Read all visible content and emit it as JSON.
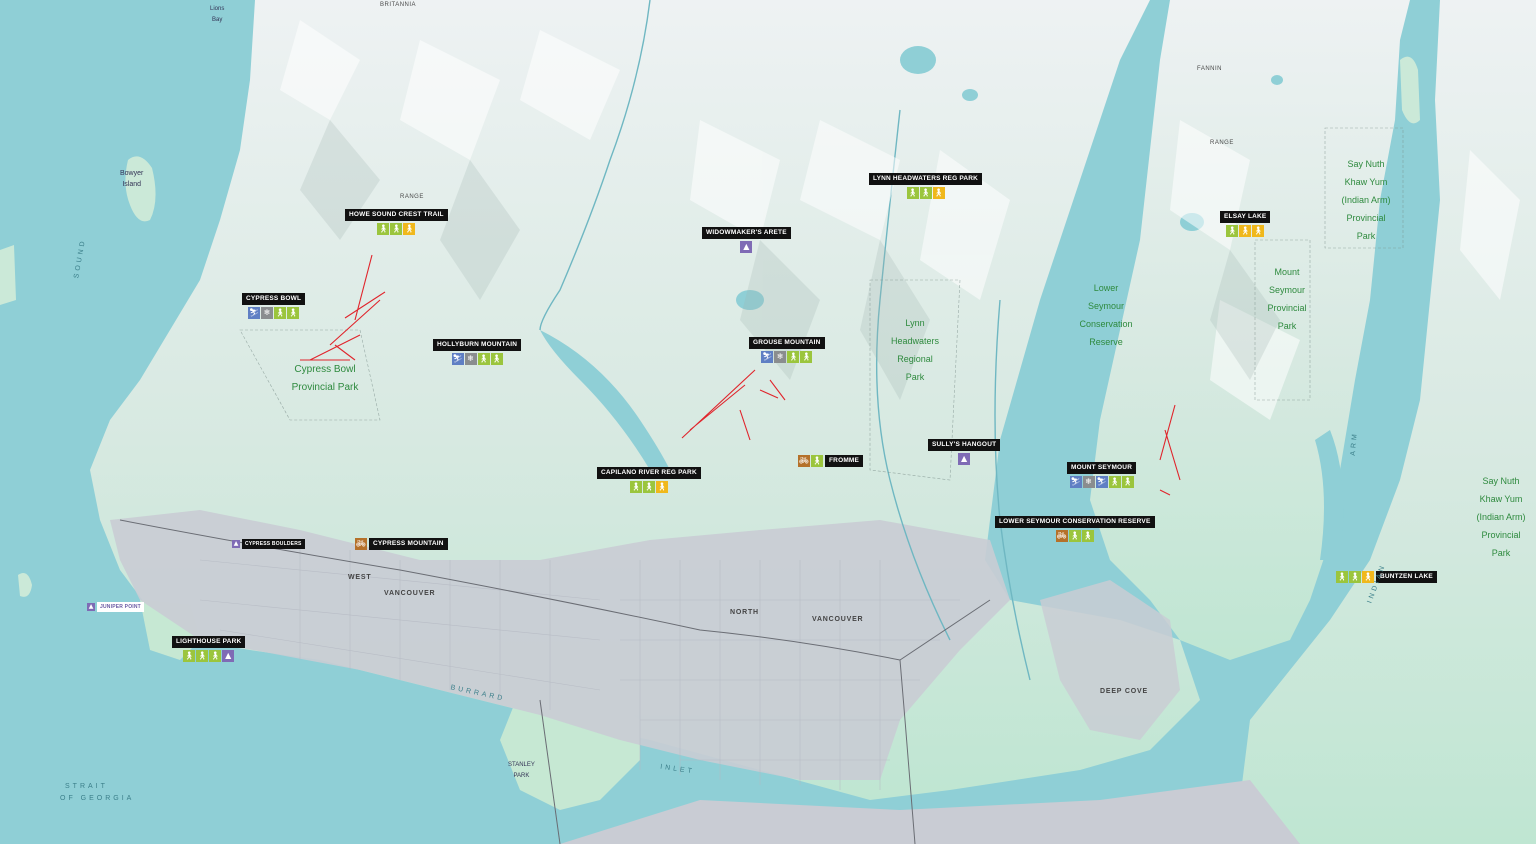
{
  "map": {
    "colors": {
      "water": "#8fcfd6",
      "land": "#bfe6d2",
      "mountain": "#e8eef0",
      "urban": "#c9ccd4",
      "park_text": "#2e8a3e",
      "lift": "#e0242b",
      "label_bg": "#111111"
    },
    "activity_colors": {
      "ski": "#5f7fc4",
      "snowshoe": "#8a8d8f",
      "hike": "#9bc53d",
      "walk": "#f0b81c",
      "climb": "#7f6bb5",
      "bike": "#b5712a"
    },
    "pois": [
      {
        "label": "HOWE SOUND CREST TRAIL",
        "icons": [
          "hike",
          "hike",
          "walk"
        ]
      },
      {
        "label": "CYPRESS BOWL",
        "icons": [
          "ski",
          "snowshoe",
          "hike",
          "hike"
        ]
      },
      {
        "label": "HOLLYBURN MOUNTAIN",
        "icons": [
          "ski",
          "snowshoe",
          "hike",
          "hike"
        ]
      },
      {
        "label": "WIDOWMAKER'S ARETE",
        "icons": [
          "climb"
        ]
      },
      {
        "label": "GROUSE MOUNTAIN",
        "icons": [
          "ski",
          "snowshoe",
          "hike",
          "hike"
        ]
      },
      {
        "label": "LYNN HEADWATERS REG PARK",
        "icons": [
          "hike",
          "hike",
          "walk"
        ]
      },
      {
        "label": "ELSAY LAKE",
        "icons": [
          "hike",
          "walk",
          "walk"
        ]
      },
      {
        "label": "CAPILANO RIVER REG PARK",
        "icons": [
          "hike",
          "hike",
          "walk"
        ]
      },
      {
        "label": "FROMME",
        "icons": [
          "bike",
          "hike"
        ]
      },
      {
        "label": "SULLY'S HANGOUT",
        "icons": [
          "climb"
        ]
      },
      {
        "label": "MOUNT SEYMOUR",
        "icons": [
          "ski",
          "snowshoe",
          "ski",
          "hike",
          "hike"
        ]
      },
      {
        "label": "LOWER SEYMOUR CONSERVATION RESERVE",
        "icons": [
          "bike",
          "hike",
          "hike"
        ]
      },
      {
        "label": "CYPRESS MOUNTAIN",
        "icons": [
          "bike"
        ]
      },
      {
        "label": "CYPRESS BOULDERS",
        "icons": [
          "climb"
        ]
      },
      {
        "label": "JUNIPER POINT",
        "icons": [
          "climb"
        ]
      },
      {
        "label": "LIGHTHOUSE PARK",
        "icons": [
          "hike",
          "hike",
          "hike",
          "climb"
        ]
      },
      {
        "label": "BUNTZEN LAKE",
        "icons": [
          "hike",
          "hike",
          "walk"
        ]
      }
    ],
    "parks": [
      {
        "name": "Cypress Bowl\nProvincial Park"
      },
      {
        "name": "Lynn\nHeadwaters\nRegional\nPark"
      },
      {
        "name": "Lower\nSeymour\nConservation\nReserve"
      },
      {
        "name": "Mount\nSeymour\nProvincial\nPark"
      },
      {
        "name": "Say Nuth\nKhaw Yum\n(Indian Arm)\nProvincial\nPark"
      },
      {
        "name": "Say Nuth\nKhaw Yum\n(Indian Arm)\nProvincial\nPark"
      }
    ],
    "places": {
      "west": "WEST",
      "vancouver_w": "VANCOUVER",
      "north": "NORTH",
      "vancouver_n": "VANCOUVER",
      "deep_cove": "DEEP COVE",
      "britannia": "BRITANNIA",
      "fannin": "FANNIN",
      "range1": "RANGE",
      "range2": "RANGE",
      "bowyer": "Bowyer\nIsland",
      "strait": "STRAIT",
      "of_georgia": "OF GEORGIA",
      "burrard": "BURRARD",
      "inlet": "INLET",
      "indian": "INDIAN",
      "arm": "ARM",
      "howe_sound": "SOUND",
      "stanley_park": "STANLEY\nPARK",
      "lions_bay": "Lions\nBay"
    }
  }
}
